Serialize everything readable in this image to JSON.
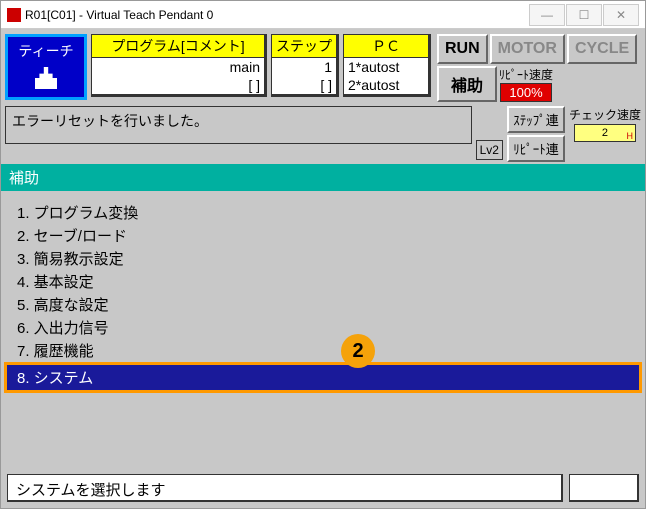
{
  "window": {
    "title": "R01[C01] - Virtual Teach Pendant 0"
  },
  "teach": {
    "label": "ティーチ"
  },
  "program_box": {
    "header": "プログラム[コメント]",
    "row1": "main",
    "row2": "[                 ]"
  },
  "step_box": {
    "header": "ステップ",
    "row1": "1",
    "row2": "[   ]"
  },
  "pc_box": {
    "header": "ＰＣ",
    "row1": "1*autost",
    "row2": "2*autost"
  },
  "buttons": {
    "run": "RUN",
    "motor": "MOTOR",
    "cycle": "CYCLE",
    "aux": "補助",
    "lv": "Lv2",
    "step_cont": "ｽﾃｯﾌﾟ連",
    "repeat_cont": "ﾘﾋﾟｰﾄ連"
  },
  "speed": {
    "repeat_label": "ﾘﾋﾟｰﾄ速度",
    "repeat_value": "100%",
    "check_label": "チェック速度",
    "check_value": "2"
  },
  "message": "エラーリセットを行いました。",
  "section": {
    "title": "補助"
  },
  "menu": {
    "items": [
      {
        "num": "1.",
        "label": "プログラム変換"
      },
      {
        "num": "2.",
        "label": "セーブ/ロード"
      },
      {
        "num": "3.",
        "label": "簡易教示設定"
      },
      {
        "num": "4.",
        "label": "基本設定"
      },
      {
        "num": "5.",
        "label": "高度な設定"
      },
      {
        "num": "6.",
        "label": "入出力信号"
      },
      {
        "num": "7.",
        "label": "履歴機能"
      },
      {
        "num": "8.",
        "label": "システム"
      }
    ],
    "selected_index": 7
  },
  "callout": {
    "label": "2"
  },
  "status": {
    "text": "システムを選択します"
  }
}
